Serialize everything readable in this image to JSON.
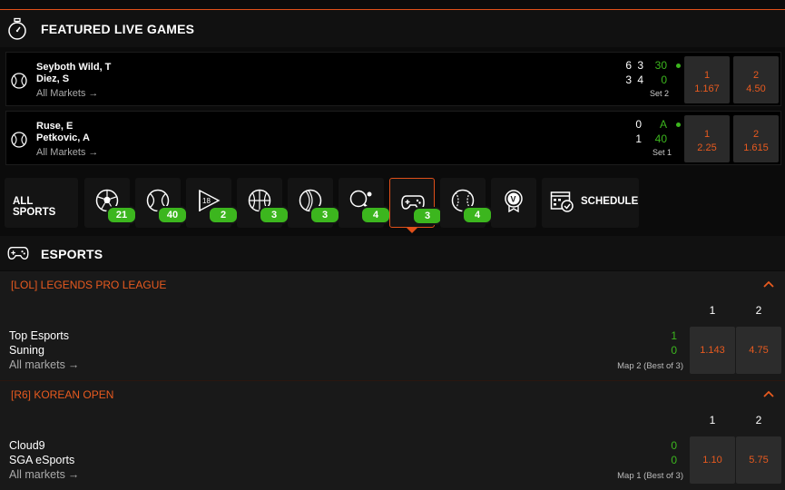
{
  "featured": {
    "title": "FEATURED LIVE GAMES",
    "matches": [
      {
        "player1": "Seyboth Wild, T",
        "player2": "Diez, S",
        "all_markets": "All Markets",
        "p1_sets": "6",
        "p1_games": "3",
        "p1_points": "30",
        "p2_sets": "3",
        "p2_games": "4",
        "p2_points": "0",
        "set_label": "Set 2",
        "odd1_label": "1",
        "odd1_value": "1.167",
        "odd2_label": "2",
        "odd2_value": "4.50"
      },
      {
        "player1": "Ruse, E",
        "player2": "Petkovic, A",
        "all_markets": "All Markets",
        "p1_sets": "0",
        "p1_points": "A",
        "p2_sets": "1",
        "p2_points": "40",
        "set_label": "Set 1",
        "odd1_label": "1",
        "odd1_value": "2.25",
        "odd2_label": "2",
        "odd2_value": "1.615"
      }
    ]
  },
  "sports_bar": {
    "all_sports_label": "ALL SPORTS",
    "schedule_label": "SCHEDULE",
    "sports": [
      {
        "icon": "soccer-icon",
        "count": "21"
      },
      {
        "icon": "tennis-icon",
        "count": "40"
      },
      {
        "icon": "golf-icon",
        "count": "2"
      },
      {
        "icon": "basketball-icon",
        "count": "3"
      },
      {
        "icon": "cricket-icon",
        "count": "3"
      },
      {
        "icon": "table-tennis-icon",
        "count": "4"
      },
      {
        "icon": "gamepad-icon",
        "count": "3"
      },
      {
        "icon": "baseball-icon",
        "count": "4"
      },
      {
        "icon": "virtual-icon",
        "count": ""
      }
    ],
    "active_index": 6
  },
  "esports": {
    "title": "ESPORTS",
    "leagues": [
      {
        "name": "[LOL] LEGENDS PRO LEAGUE",
        "col1": "1",
        "col2": "2",
        "team1": "Top Esports",
        "team2": "Suning",
        "all_markets": "All markets",
        "score1": "1",
        "score2": "0",
        "map_label": "Map 2 (Best of 3)",
        "odd1": "1.143",
        "odd2": "4.75"
      },
      {
        "name": "[R6] KOREAN OPEN",
        "col1": "1",
        "col2": "2",
        "team1": "Cloud9",
        "team2": "SGA eSports",
        "all_markets": "All markets",
        "score1": "0",
        "score2": "0",
        "map_label": "Map 1 (Best of 3)",
        "odd1": "1.10",
        "odd2": "5.75"
      }
    ]
  },
  "colors": {
    "accent": "#e0501a",
    "odds_text": "#e85a1f",
    "live_green": "#3cb61e"
  }
}
